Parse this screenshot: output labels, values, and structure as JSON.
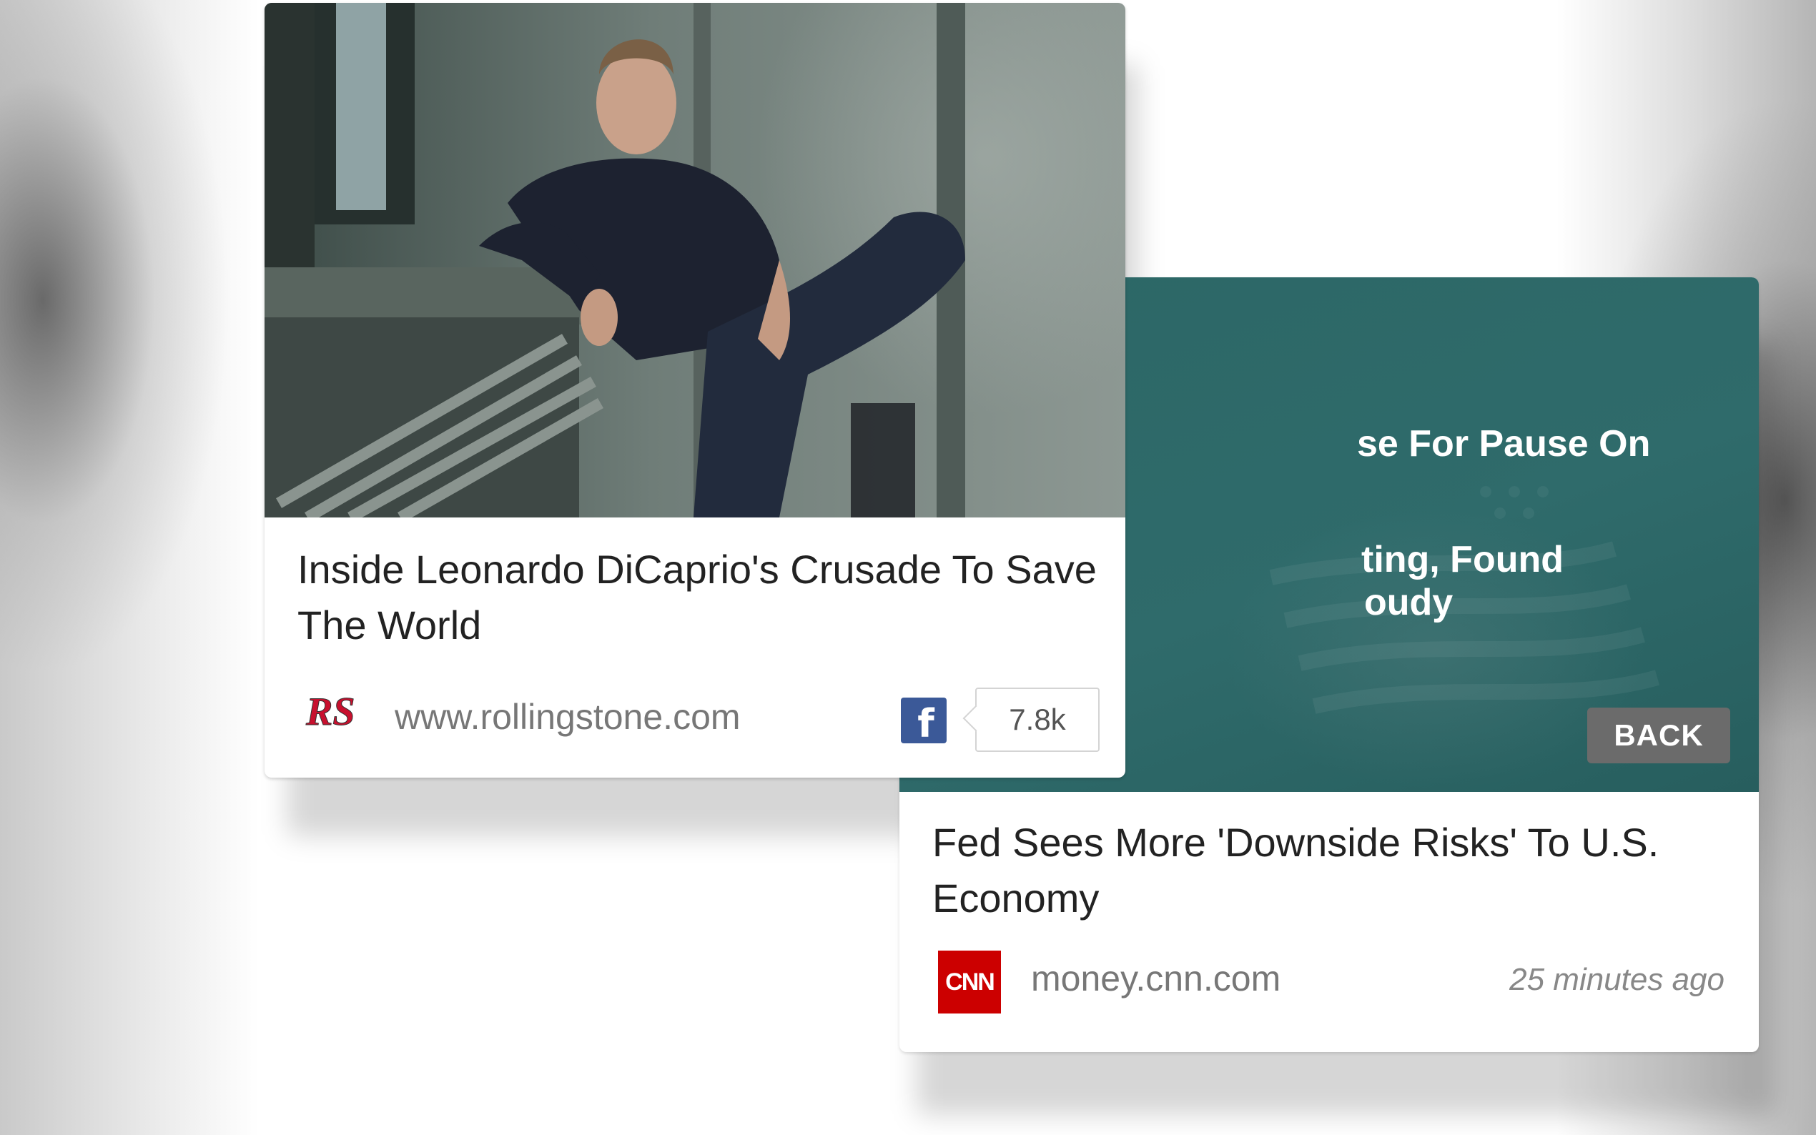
{
  "front_card": {
    "title": "Inside Leonardo DiCaprio's Crusade To Save The World",
    "source_logo": "RS",
    "domain": "www.rollingstone.com",
    "share_icon": "facebook-icon",
    "share_glyph": "f",
    "share_count": "7.8k"
  },
  "back_card": {
    "overlay_line1": "se For Pause On",
    "overlay_line2": "ting, Found",
    "overlay_line3": "oudy",
    "back_button": "BACK",
    "title": "Fed Sees More 'Downside Risks' To U.S. Economy",
    "source_logo": "CNN",
    "domain": "money.cnn.com",
    "timestamp": "25 minutes ago"
  },
  "colors": {
    "overlay_teal": "#2f6b6b",
    "facebook_blue": "#3b5998",
    "cnn_red": "#cc0000",
    "rs_red": "#c8102e"
  }
}
